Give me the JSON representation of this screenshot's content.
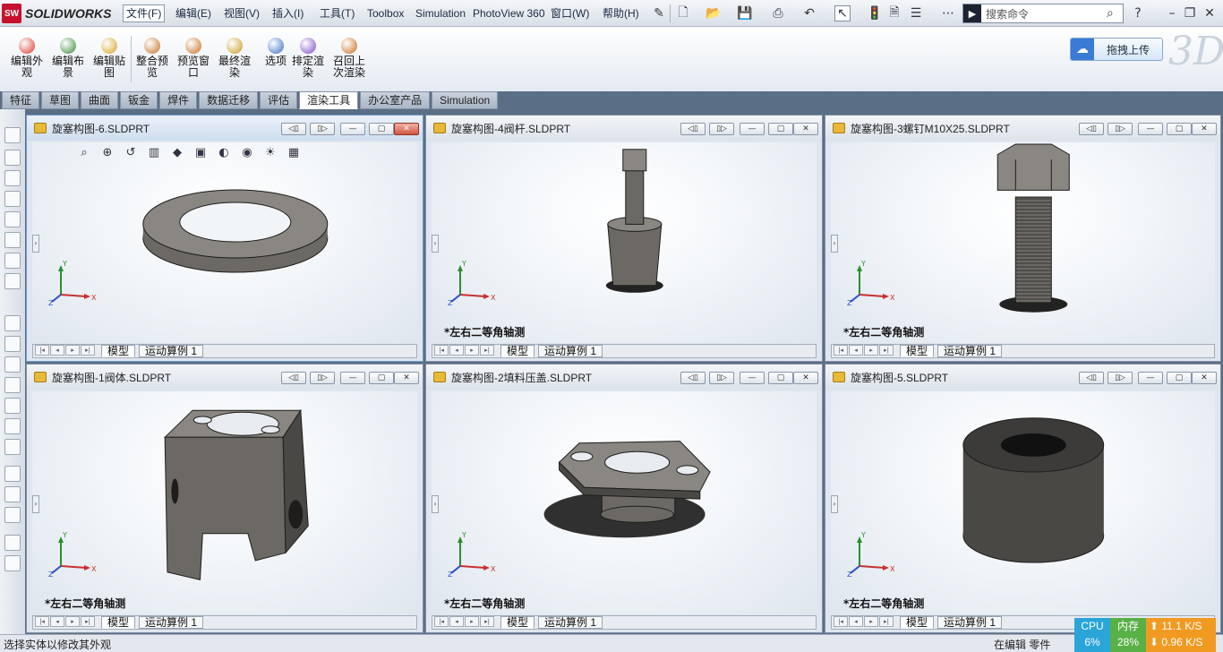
{
  "app": {
    "logo_badge": "SW",
    "logo_text": "SOLIDWORKS"
  },
  "menu": [
    "文件(F)",
    "编辑(E)",
    "视图(V)",
    "插入(I)",
    "工具(T)",
    "Toolbox",
    "Simulation",
    "PhotoView 360",
    "窗口(W)",
    "帮助(H)"
  ],
  "search": {
    "placeholder": "搜索命令"
  },
  "ribbon": {
    "buttons": [
      {
        "label": "编辑外\n观",
        "color": "#d83a2a"
      },
      {
        "label": "编辑布\n景",
        "color": "#3a8a3a"
      },
      {
        "label": "编辑贴\n图",
        "color": "#d8a21e"
      },
      {
        "label": "整合预\n览",
        "color": "#c96e1e"
      },
      {
        "label": "预览窗\n口",
        "color": "#c96e1e"
      },
      {
        "label": "最终渲\n染",
        "color": "#c99a1e"
      },
      {
        "label": "选项",
        "color": "#3a6ac9"
      },
      {
        "label": "排定渲\n染",
        "color": "#7a4ac9"
      },
      {
        "label": "召回上\n次渲染",
        "color": "#c96e1e"
      }
    ],
    "upload_label": "拖拽上传"
  },
  "tabs": [
    "特征",
    "草图",
    "曲面",
    "钣金",
    "焊件",
    "数据迁移",
    "评估",
    "渲染工具",
    "办公室产品",
    "Simulation"
  ],
  "active_tab": "渲染工具",
  "windows": [
    {
      "title": "旋塞构图-6.SLDPRT",
      "active": true,
      "view_label": "",
      "model_tab": "模型",
      "motion_tab": "运动算例 1",
      "shape": "ring"
    },
    {
      "title": "旋塞构图-4阀杆.SLDPRT",
      "active": false,
      "view_label": "*左右二等角轴测",
      "model_tab": "模型",
      "motion_tab": "运动算例 1",
      "shape": "stem"
    },
    {
      "title": "旋塞构图-3螺钉M10X25.SLDPRT",
      "active": false,
      "view_label": "*左右二等角轴测",
      "model_tab": "模型",
      "motion_tab": "运动算例 1",
      "shape": "bolt"
    },
    {
      "title": "旋塞构图-1阀体.SLDPRT",
      "active": false,
      "view_label": "*左右二等角轴测",
      "model_tab": "模型",
      "motion_tab": "运动算例 1",
      "shape": "block"
    },
    {
      "title": "旋塞构图-2填料压盖.SLDPRT",
      "active": false,
      "view_label": "*左右二等角轴测",
      "model_tab": "模型",
      "motion_tab": "运动算例 1",
      "shape": "gland"
    },
    {
      "title": "旋塞构图-5.SLDPRT",
      "active": false,
      "view_label": "*左右二等角轴测",
      "model_tab": "模型",
      "motion_tab": "运动算例 1",
      "shape": "cylinder"
    }
  ],
  "axis_labels": {
    "x": "X",
    "y": "Y",
    "z": "Z"
  },
  "status": {
    "left": "选择实体以修改其外观",
    "mode": "在编辑 零件"
  },
  "monitor": {
    "cpu_label": "CPU",
    "cpu_value": "6%",
    "mem_label": "内存",
    "mem_value": "28%",
    "up": "11.1 K/S",
    "down": "0.96 K/S"
  }
}
